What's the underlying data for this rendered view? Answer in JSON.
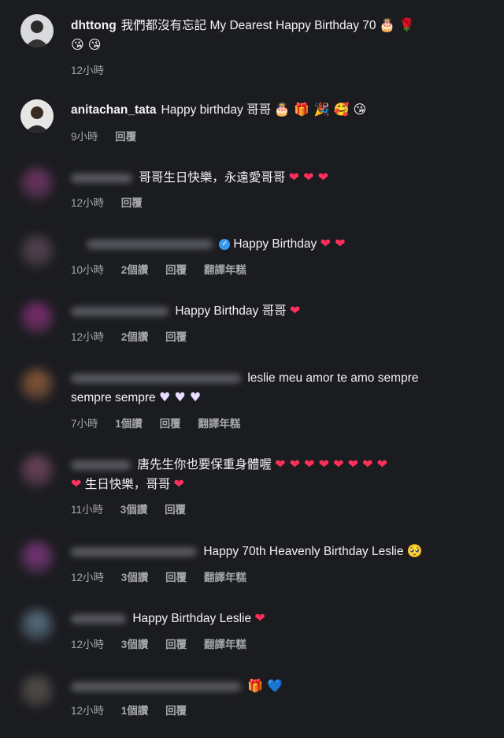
{
  "comments": [
    {
      "username": "dhttong",
      "text": "我們都沒有忘記 My Dearest Happy Birthday 70",
      "emojis_line1": "🎂 🌹",
      "emojis_line2": "😘 😘",
      "time": "12小時"
    },
    {
      "username": "anitachan_tata",
      "text": "Happy birthday 哥哥",
      "emojis": "🎂 🎁 🎉 🥰 😘",
      "time": "9小時",
      "reply": "回覆"
    },
    {
      "text": "哥哥生日快樂，永遠愛哥哥",
      "emojis": "❤ ❤ ❤",
      "time": "12小時",
      "reply": "回覆"
    },
    {
      "text": "Happy Birthday",
      "emojis": "❤ ❤",
      "time": "10小時",
      "likes": "2個讚",
      "reply": "回覆",
      "translate": "翻譯年糕"
    },
    {
      "text": "Happy Birthday 哥哥",
      "emojis": "❤",
      "time": "12小時",
      "likes": "2個讚",
      "reply": "回覆"
    },
    {
      "text_line1": "leslie meu amor te amo sempre",
      "text_line2": "sempre sempre",
      "emojis": "♥ ♥ ♥",
      "time": "7小時",
      "likes": "1個讚",
      "reply": "回覆",
      "translate": "翻譯年糕"
    },
    {
      "text_line1": "唐先生你也要保重身體喔",
      "emojis_line1": "❤ ❤ ❤ ❤ ❤ ❤ ❤ ❤",
      "text_line2": "生日快樂，哥哥",
      "time": "11小時",
      "likes": "3個讚",
      "reply": "回覆"
    },
    {
      "text": "Happy 70th Heavenly Birthday Leslie",
      "emojis": "🥺",
      "time": "12小時",
      "likes": "3個讚",
      "reply": "回覆",
      "translate": "翻譯年糕"
    },
    {
      "text": "Happy Birthday Leslie",
      "emojis": "❤",
      "time": "12小時",
      "likes": "3個讚",
      "reply": "回覆",
      "translate": "翻譯年糕"
    },
    {
      "emojis": "🎁 💙",
      "time": "12小時",
      "likes": "1個讚",
      "reply": "回覆"
    }
  ]
}
